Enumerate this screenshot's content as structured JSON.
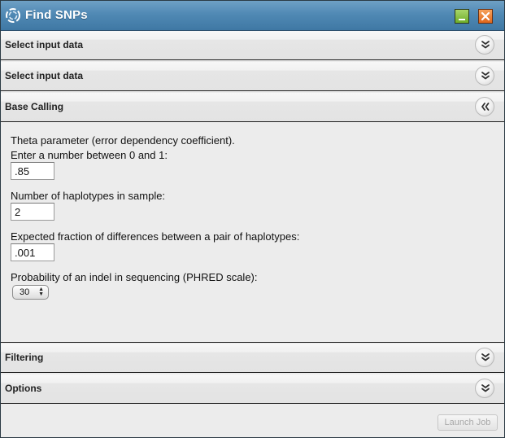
{
  "window": {
    "title": "Find SNPs",
    "logo_icon": "swirl-logo-icon",
    "minimize_icon": "minimize-icon",
    "close_icon": "close-icon"
  },
  "sections": [
    {
      "label": "Select input data",
      "state": "collapsed",
      "toggle_icon": "double-chevron-down-icon"
    },
    {
      "label": "Select input data",
      "state": "collapsed",
      "toggle_icon": "double-chevron-down-icon"
    },
    {
      "label": "Base Calling",
      "state": "expanded",
      "toggle_icon": "double-chevron-left-icon"
    },
    {
      "label": "Filtering",
      "state": "collapsed",
      "toggle_icon": "double-chevron-down-icon"
    },
    {
      "label": "Options",
      "state": "collapsed",
      "toggle_icon": "double-chevron-down-icon"
    }
  ],
  "base_calling": {
    "theta_label_line1": "Theta parameter (error dependency coefficient).",
    "theta_label_line2": "Enter a number between 0 and 1:",
    "theta_value": ".85",
    "haplotypes_label": "Number of haplotypes in sample:",
    "haplotypes_value": "2",
    "fraction_label": "Expected fraction of differences between a pair of haplotypes:",
    "fraction_value": ".001",
    "indel_label": "Probability of an indel in sequencing (PHRED scale):",
    "indel_value": "30"
  },
  "footer": {
    "launch_label": "Launch Job",
    "launch_enabled": false
  },
  "colors": {
    "titlebar": "#5089b4",
    "panel_bg": "#ececec",
    "minimize": "#8bc34a",
    "close": "#e8782a"
  }
}
